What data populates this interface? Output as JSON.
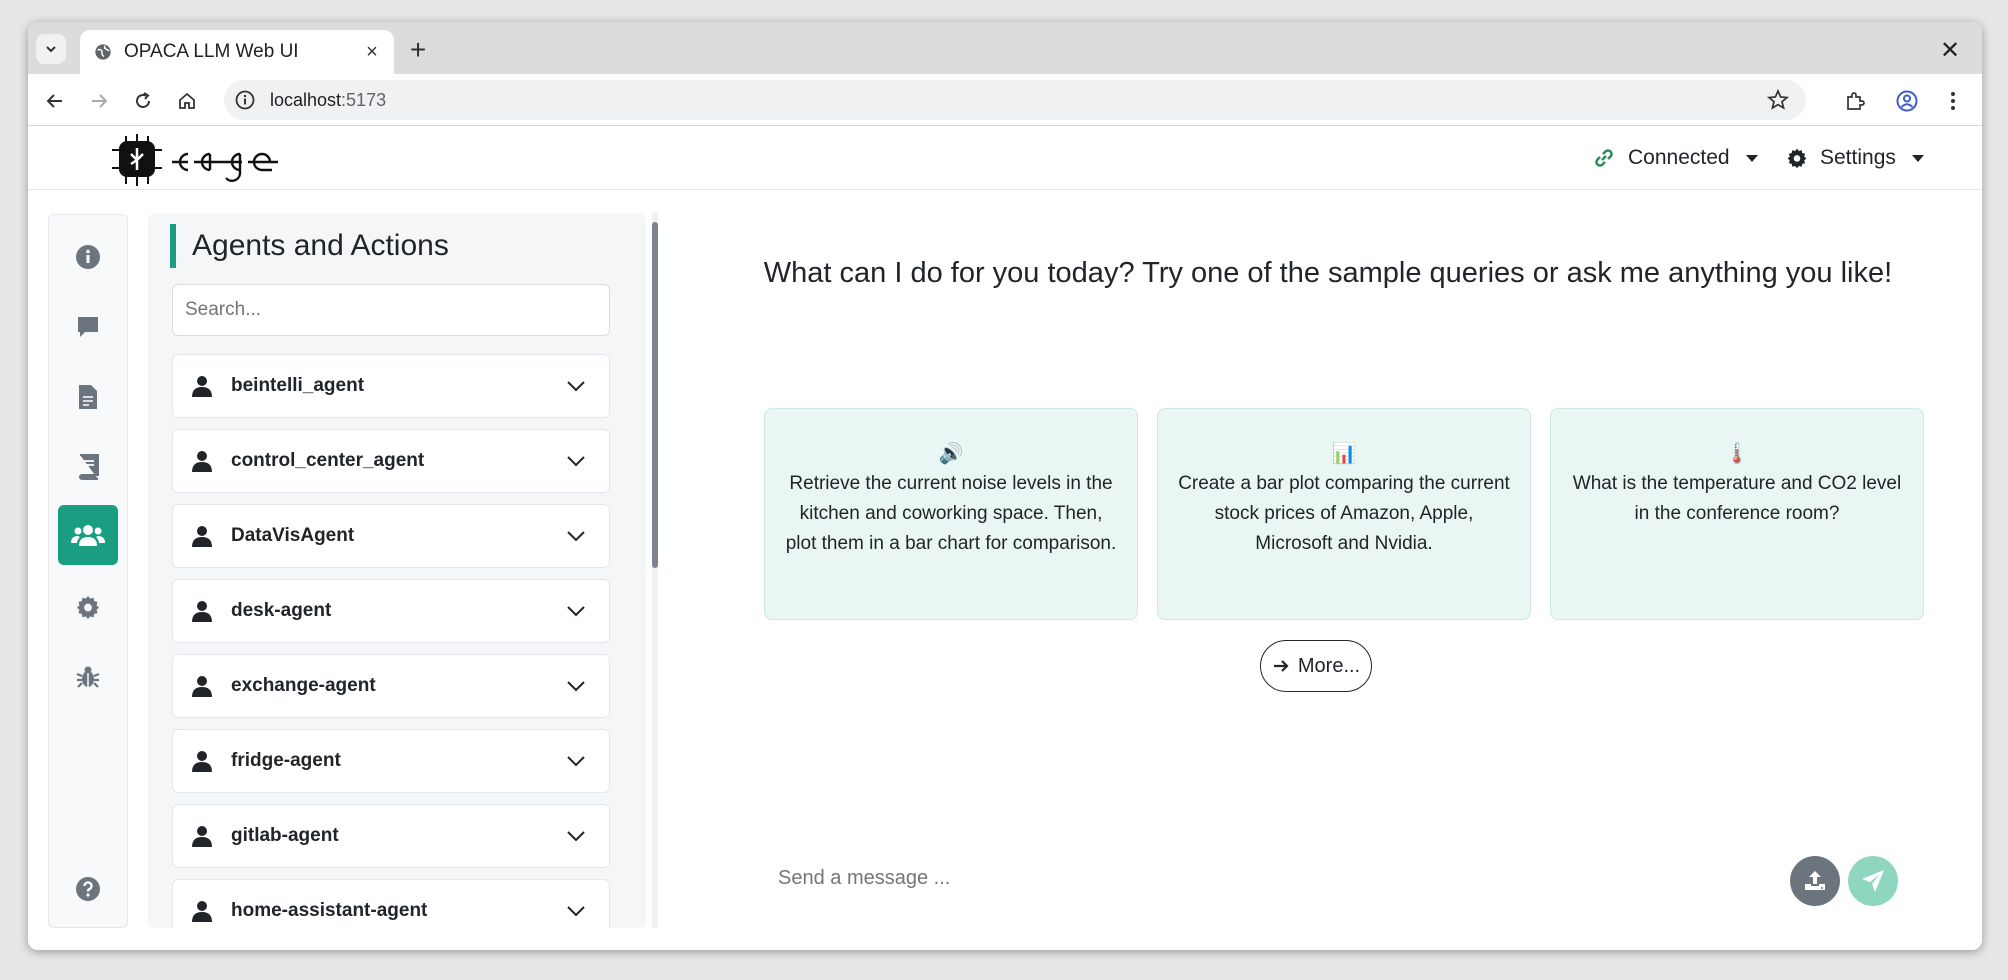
{
  "browser": {
    "tab_title": "OPACA LLM Web UI",
    "url_host": "localhost",
    "url_port": ":5173"
  },
  "navbar": {
    "connection_label": "Connected",
    "settings_label": "Settings",
    "connection_color": "#2e8b57"
  },
  "sidebar": {
    "icons": [
      "info-icon",
      "chat-icon",
      "document-icon",
      "book-icon",
      "agents-icon",
      "gear-icon",
      "bug-icon",
      "help-icon"
    ],
    "active": "agents-icon",
    "accent": "#1a9e82"
  },
  "agents_panel": {
    "title": "Agents and Actions",
    "search_placeholder": "Search...",
    "agents": [
      "beintelli_agent",
      "control_center_agent",
      "DataVisAgent",
      "desk-agent",
      "exchange-agent",
      "fridge-agent",
      "gitlab-agent",
      "home-assistant-agent"
    ]
  },
  "chat": {
    "welcome": "What can I do for you today? Try one of the sample queries or ask me anything you like!",
    "samples": [
      {
        "icon": "🔊",
        "text": "Retrieve the current noise levels in the kitchen and coworking space. Then, plot them in a bar chart for comparison."
      },
      {
        "icon": "📊",
        "text": "Create a bar plot comparing the current stock prices of Amazon, Apple, Microsoft and Nvidia."
      },
      {
        "icon": "🌡️",
        "text": "What is the temperature and CO2 level in the conference room?"
      }
    ],
    "more_label": "More...",
    "input_placeholder": "Send a message ..."
  }
}
